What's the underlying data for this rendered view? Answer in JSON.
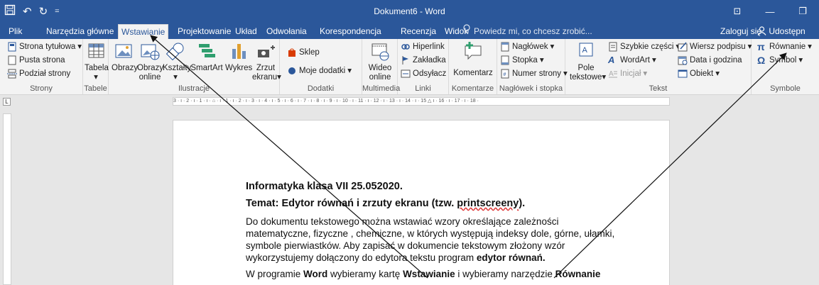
{
  "titlebar": {
    "qat_save_icon": "save-icon",
    "qat_undo": "↶",
    "qat_redo": "↻",
    "qat_more": "=",
    "title": "Dokument6 - Word",
    "ribbon_display": "⊡",
    "minimize": "—",
    "maximize": "❐"
  },
  "tabs": [
    "Plik",
    "Narzędzia główne",
    "Wstawianie",
    "Projektowanie",
    "Układ",
    "Odwołania",
    "Korespondencja",
    "Recenzja",
    "Widok"
  ],
  "active_tab": "Wstawianie",
  "tell_me": "Powiedz mi, co chcesz zrobić...",
  "sign_in": "Zaloguj się",
  "share": "Udostępn",
  "ribbon": {
    "strony": {
      "label": "Strony",
      "items": [
        "Strona tytułowa",
        "Pusta strona",
        "Podział strony"
      ]
    },
    "tabele": {
      "label": "Tabele",
      "tabela": "Tabela"
    },
    "ilustracje": {
      "label": "Ilustracje",
      "obrazy": "Obrazy",
      "obrazy_online_1": "Obrazy",
      "obrazy_online_2": "online",
      "ksztalty": "Kształty",
      "smartart": "SmartArt",
      "wykres": "Wykres",
      "zrzut_1": "Zrzut",
      "zrzut_2": "ekranu"
    },
    "dodatki": {
      "label": "Dodatki",
      "sklep": "Sklep",
      "moje": "Moje dodatki"
    },
    "multimedia": {
      "label": "Multimedia",
      "wideo_1": "Wideo",
      "wideo_2": "online"
    },
    "linki": {
      "label": "Linki",
      "items": [
        "Hiperlink",
        "Zakładka",
        "Odsyłacz"
      ]
    },
    "komentarze": {
      "label": "Komentarze",
      "komentarz": "Komentarz"
    },
    "naglowek": {
      "label": "Nagłówek i stopka",
      "items": [
        "Nagłówek",
        "Stopka",
        "Numer strony"
      ]
    },
    "tekst": {
      "label": "Tekst",
      "pole_1": "Pole",
      "pole_2": "tekstowe",
      "szybkie": "Szybkie części",
      "wordart": "WordArt",
      "inicjal": "Inicjał",
      "wiersz": "Wiersz podpisu",
      "data": "Data i godzina",
      "obiekt": "Obiekt"
    },
    "symbole": {
      "label": "Symbole",
      "rownanie": "Równanie",
      "symbol": "Symbol"
    }
  },
  "ruler_text": "3 · ı · 2 · ı · 1 · ı · ⌂ · ı · 1 · ı · 2 · ı · 3 · ı · 4 · ı · 5 · ı · 6 · ı · 7 · ı · 8 · ı · 9 · ı · 10 · ı · 11 · ı · 12 · ı · 13 · ı · 14 · ı · 15 △ ı · 16 · ı · 17 · ı · 18 ·",
  "tab_selector": "L",
  "document": {
    "heading1": "Informatyka klasa VII 25.052020.",
    "heading2_prefix": "Temat: Edytor równań i zrzuty ekranu (tzw. ",
    "heading2_squiggle": "printscreeny",
    "heading2_suffix": ").",
    "para1_prefix": "Do dokumentu tekstowego można wstawiać wzory określające zależności matematyczne, fizyczne , chemiczne, w których występują indeksy dole, górne, ułamki, symbole pierwiastków. Aby zapisać w dokumencie tekstowym złożony wzór wykorzystujemy dołączony do edytora tekstu program ",
    "para1_bold": "edytor równań.",
    "para2_a": "W programie ",
    "para2_b": "Word",
    "para2_c": " wybieramy kartę ",
    "para2_d": "Wstawianie",
    "para2_e": " i wybieramy narzędzie ",
    "para2_f": "Równanie"
  },
  "colors": {
    "word_blue": "#2b579a",
    "ribbon_bg": "#f3f3f3",
    "canvas": "#e6e6e6"
  }
}
